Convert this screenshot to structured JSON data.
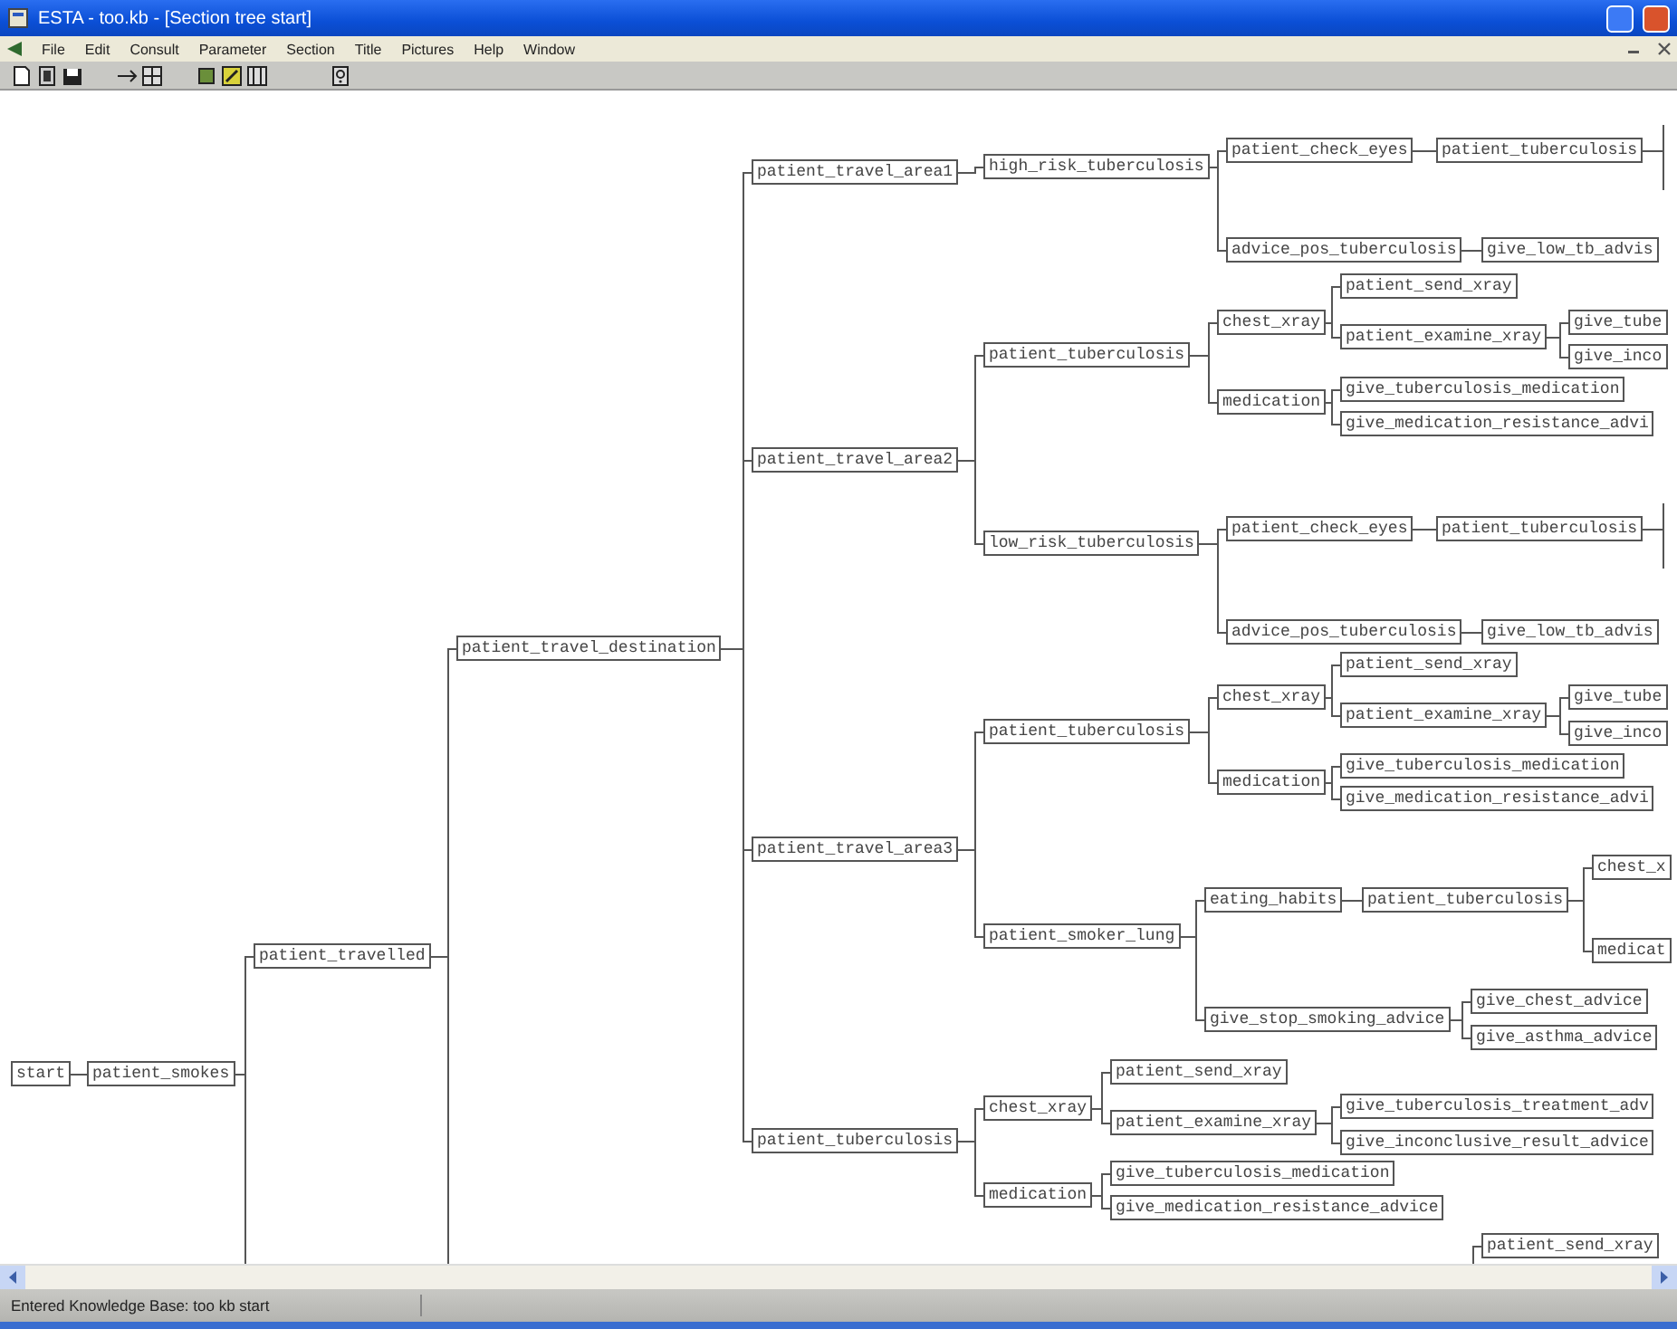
{
  "window": {
    "title": "ESTA - too.kb - [Section tree start]"
  },
  "menu": [
    "File",
    "Edit",
    "Consult",
    "Parameter",
    "Section",
    "Title",
    "Pictures",
    "Help",
    "Window"
  ],
  "tree": {
    "label": "start",
    "children": [
      {
        "label": "patient_smokes",
        "children": [
          {
            "label": "patient_travelled",
            "children": [
              {
                "label": "patient_travel_destination",
                "children": [
                  {
                    "label": "patient_travel_area1",
                    "children": [
                      {
                        "label": "high_risk_tuberculosis",
                        "children": [
                          {
                            "label": "patient_check_eyes",
                            "children": [
                              {
                                "label": "patient_tuberculosis"
                              }
                            ]
                          },
                          {
                            "label": "advice_pos_tuberculosis",
                            "children": [
                              {
                                "label": "give_low_tb_advis"
                              }
                            ]
                          }
                        ]
                      }
                    ]
                  },
                  {
                    "label": "patient_travel_area2",
                    "children": [
                      {
                        "label": "patient_tuberculosis",
                        "children": [
                          {
                            "label": "chest_xray",
                            "children": [
                              {
                                "label": "patient_send_xray"
                              },
                              {
                                "label": "patient_examine_xray",
                                "children": [
                                  {
                                    "label": "give_tube"
                                  },
                                  {
                                    "label": "give_inco"
                                  }
                                ]
                              }
                            ]
                          },
                          {
                            "label": "medication",
                            "children": [
                              {
                                "label": "give_tuberculosis_medication"
                              },
                              {
                                "label": "give_medication_resistance_advi"
                              }
                            ]
                          }
                        ]
                      },
                      {
                        "label": "low_risk_tuberculosis",
                        "children": [
                          {
                            "label": "patient_check_eyes",
                            "children": [
                              {
                                "label": "patient_tuberculosis"
                              }
                            ]
                          },
                          {
                            "label": "advice_pos_tuberculosis",
                            "children": [
                              {
                                "label": "give_low_tb_advis"
                              }
                            ]
                          }
                        ]
                      }
                    ]
                  },
                  {
                    "label": "patient_travel_area3",
                    "children": [
                      {
                        "label": "patient_tuberculosis",
                        "children": [
                          {
                            "label": "chest_xray",
                            "children": [
                              {
                                "label": "patient_send_xray"
                              },
                              {
                                "label": "patient_examine_xray",
                                "children": [
                                  {
                                    "label": "give_tube"
                                  },
                                  {
                                    "label": "give_inco"
                                  }
                                ]
                              }
                            ]
                          },
                          {
                            "label": "medication",
                            "children": [
                              {
                                "label": "give_tuberculosis_medication"
                              },
                              {
                                "label": "give_medication_resistance_advi"
                              }
                            ]
                          }
                        ]
                      },
                      {
                        "label": "patient_smoker_lung",
                        "children": [
                          {
                            "label": "eating_habits",
                            "children": [
                              {
                                "label": "patient_tuberculosis",
                                "children": [
                                  {
                                    "label": "chest_x"
                                  },
                                  {
                                    "label": "medicat"
                                  }
                                ]
                              }
                            ]
                          },
                          {
                            "label": "give_stop_smoking_advice",
                            "children": [
                              {
                                "label": "give_chest_advice"
                              },
                              {
                                "label": "give_asthma_advice"
                              }
                            ]
                          }
                        ]
                      }
                    ]
                  },
                  {
                    "label": "patient_tuberculosis",
                    "children": [
                      {
                        "label": "chest_xray",
                        "children": [
                          {
                            "label": "patient_send_xray"
                          },
                          {
                            "label": "patient_examine_xray",
                            "children": [
                              {
                                "label": "give_tuberculosis_treatment_adv"
                              },
                              {
                                "label": "give_inconclusive_result_advice"
                              }
                            ]
                          }
                        ]
                      },
                      {
                        "label": "medication",
                        "children": [
                          {
                            "label": "give_tuberculosis_medication"
                          },
                          {
                            "label": "give_medication_resistance_advice"
                          }
                        ]
                      }
                    ]
                  }
                ]
              }
            ]
          }
        ]
      }
    ]
  },
  "fragments": [
    {
      "label": "patient_send_xray"
    }
  ],
  "status_bar": {
    "text": "Entered Knowledge Base: too kb start"
  }
}
